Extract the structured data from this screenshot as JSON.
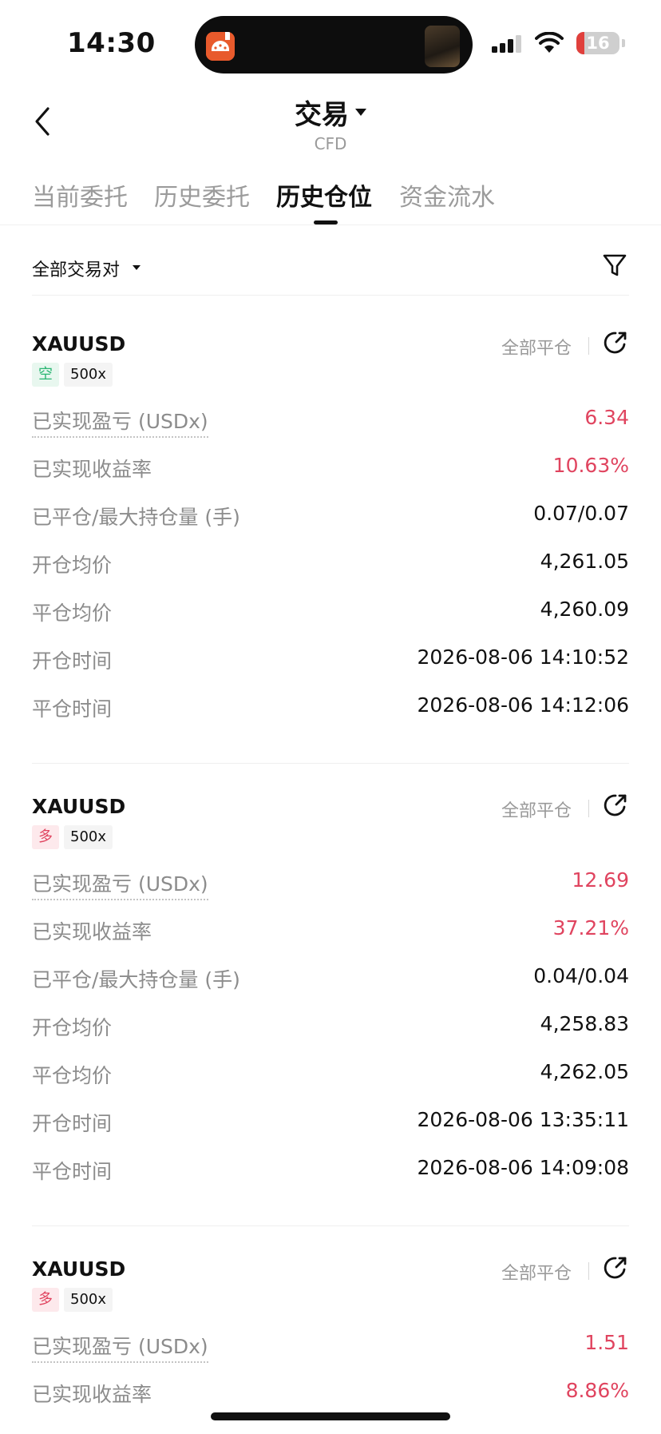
{
  "status_bar": {
    "time": "14:30",
    "battery": "16",
    "icons": [
      "signal-icon",
      "wifi-icon",
      "battery-icon"
    ]
  },
  "header": {
    "title": "交易",
    "subtitle": "CFD"
  },
  "tabs": [
    {
      "label": "当前委托",
      "active": false
    },
    {
      "label": "历史委托",
      "active": false
    },
    {
      "label": "历史仓位",
      "active": true
    },
    {
      "label": "资金流水",
      "active": false
    }
  ],
  "filter": {
    "pair_label": "全部交易对"
  },
  "colors": {
    "profit": "#e0445f",
    "short_tag": "#2bb673",
    "long_tag": "#e0445f"
  },
  "positions": [
    {
      "symbol": "XAUUSD",
      "side": "空",
      "leverage": "500x",
      "close_all": "全部平仓",
      "rows": [
        {
          "label": "已实现盈亏 (USDx)",
          "value": "6.34"
        },
        {
          "label": "已实现收益率",
          "value": "10.63%"
        },
        {
          "label": "已平仓/最大持仓量 (手)",
          "value": "0.07/0.07"
        },
        {
          "label": "开仓均价",
          "value": "4,261.05"
        },
        {
          "label": "平仓均价",
          "value": "4,260.09"
        },
        {
          "label": "开仓时间",
          "value": "2026-08-06 14:10:52"
        },
        {
          "label": "平仓时间",
          "value": "2026-08-06 14:12:06"
        }
      ]
    },
    {
      "symbol": "XAUUSD",
      "side": "多",
      "leverage": "500x",
      "close_all": "全部平仓",
      "rows": [
        {
          "label": "已实现盈亏 (USDx)",
          "value": "12.69"
        },
        {
          "label": "已实现收益率",
          "value": "37.21%"
        },
        {
          "label": "已平仓/最大持仓量 (手)",
          "value": "0.04/0.04"
        },
        {
          "label": "开仓均价",
          "value": "4,258.83"
        },
        {
          "label": "平仓均价",
          "value": "4,262.05"
        },
        {
          "label": "开仓时间",
          "value": "2026-08-06 13:35:11"
        },
        {
          "label": "平仓时间",
          "value": "2026-08-06 14:09:08"
        }
      ]
    },
    {
      "symbol": "XAUUSD",
      "side": "多",
      "leverage": "500x",
      "close_all": "全部平仓",
      "rows": [
        {
          "label": "已实现盈亏 (USDx)",
          "value": "1.51"
        },
        {
          "label": "已实现收益率",
          "value": "8.86%"
        }
      ]
    }
  ]
}
